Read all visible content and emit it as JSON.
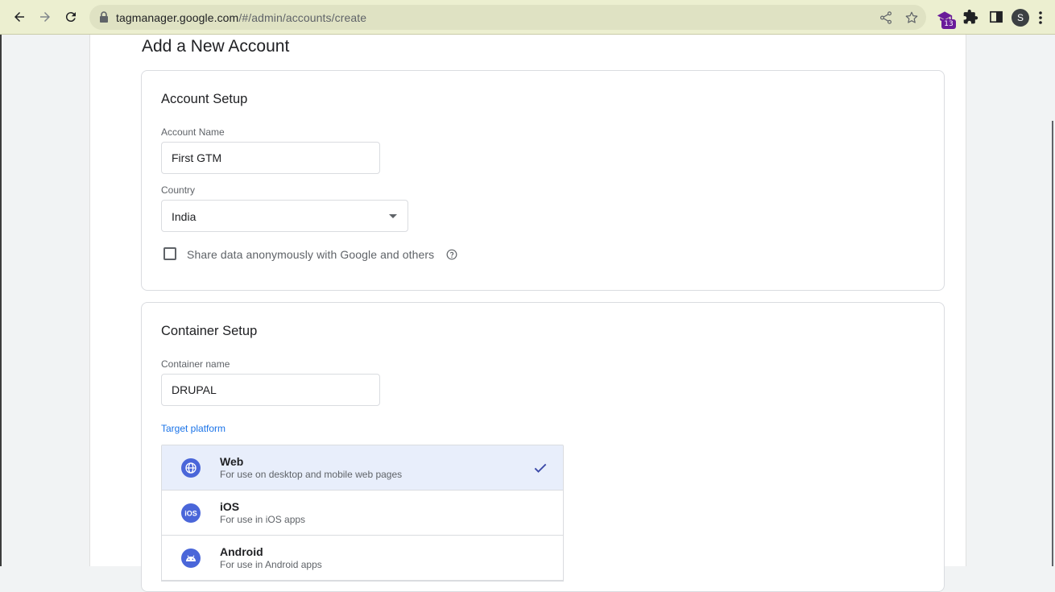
{
  "browser": {
    "url_host": "tagmanager.google.com",
    "url_path": "/#/admin/accounts/create",
    "extension_badge": "13",
    "profile_initial": "S"
  },
  "page": {
    "title": "Add a New Account"
  },
  "account_setup": {
    "title": "Account Setup",
    "account_name_label": "Account Name",
    "account_name_value": "First GTM",
    "country_label": "Country",
    "country_value": "India",
    "share_data_label": "Share data anonymously with Google and others",
    "share_data_checked": false
  },
  "container_setup": {
    "title": "Container Setup",
    "container_name_label": "Container name",
    "container_name_value": "DRUPAL",
    "target_platform_label": "Target platform",
    "platforms": [
      {
        "name": "Web",
        "description": "For use on desktop and mobile web pages",
        "icon": "globe-icon",
        "selected": true
      },
      {
        "name": "iOS",
        "description": "For use in iOS apps",
        "icon": "ios-icon",
        "selected": false
      },
      {
        "name": "Android",
        "description": "For use in Android apps",
        "icon": "android-icon",
        "selected": false
      }
    ]
  },
  "colors": {
    "accent": "#1a73e8",
    "platform_icon": "#4a66d9",
    "selected_row": "#e8eefb",
    "chrome_bar": "#ecefd0"
  }
}
